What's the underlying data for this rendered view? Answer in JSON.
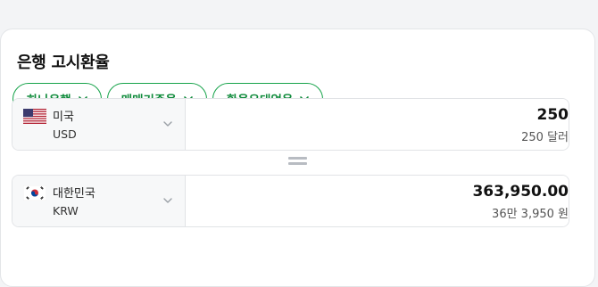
{
  "title": "은행 고시환율",
  "filters": [
    {
      "label": "하나은행"
    },
    {
      "label": "매매기준율"
    },
    {
      "label": "환율우대없음"
    }
  ],
  "from": {
    "flag": "us-flag-icon",
    "name": "미국",
    "code": "USD",
    "value": "250",
    "text": "250 달러"
  },
  "to": {
    "flag": "kr-flag-icon",
    "name": "대한민국",
    "code": "KRW",
    "value": "363,950.00",
    "text": "36만 3,950 원"
  },
  "colors": {
    "accent": "#16a34a",
    "chip_text": "#0e8a3a"
  }
}
